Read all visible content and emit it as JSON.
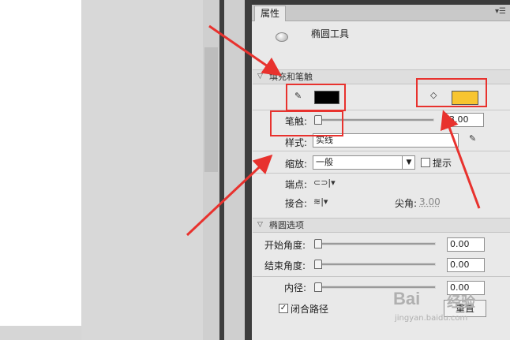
{
  "panel": {
    "tab_label": "属性",
    "menu_icon": "panel-menu-icon",
    "tool_name": "椭圆工具"
  },
  "fill_stroke": {
    "section_title": "填充和笔触",
    "stroke_color": "#000000",
    "fill_color": "#f7c530",
    "stroke_label": "笔触:",
    "stroke_value": "3.00",
    "style_label": "样式:",
    "style_value": "实线",
    "scale_label": "缩放:",
    "scale_value": "一般",
    "hint_label": "提示",
    "cap_label": "端点:",
    "join_label": "接合:",
    "miter_label": "尖角:",
    "miter_value": "3.00"
  },
  "oval_options": {
    "section_title": "椭圆选项",
    "start_angle_label": "开始角度:",
    "start_angle_value": "0.00",
    "end_angle_label": "结束角度:",
    "end_angle_value": "0.00",
    "inner_radius_label": "内径:",
    "inner_radius_value": "0.00",
    "close_path_label": "闭合路径",
    "reset_label": "重置"
  },
  "watermark": {
    "brand": "Bai",
    "brand2": "经验",
    "url": "jingyan.baidu.com"
  },
  "annotation_color": "#e8322e"
}
